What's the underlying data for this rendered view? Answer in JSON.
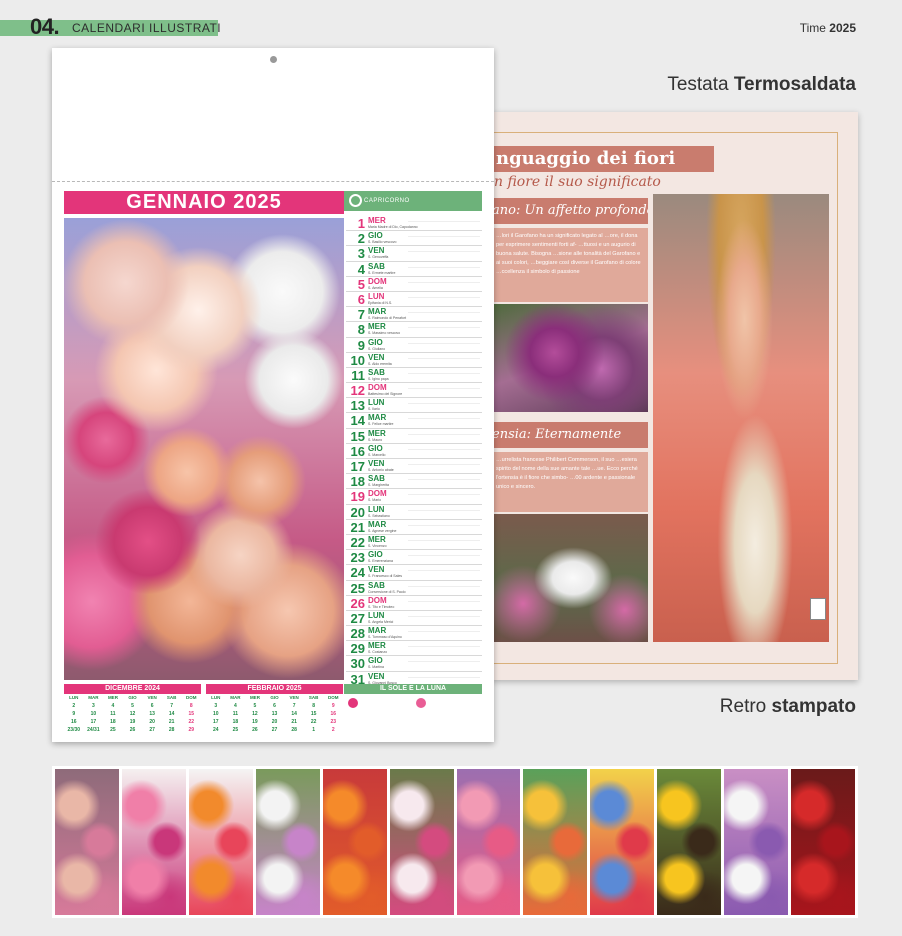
{
  "header": {
    "section_number": "04.",
    "section_title": "CALENDARI ILLUSTRATI",
    "brand": "Time",
    "year": "2025"
  },
  "captions": {
    "top_prefix": "Testata",
    "top_strong": "Termosaldata",
    "bottom_prefix": "Retro",
    "bottom_strong": "stampato"
  },
  "back": {
    "title": "nguaggio dei fiori",
    "subtitle": "n fiore il suo significato",
    "band1": "ano: Un affetto profondo",
    "text1": "…lori il Garofano ha un significato legato al …ore, il dona per esprimere sentimenti forti af- …ttuosi e un augurio di buona salute. Bisogna …sione alle tonalità del Garofano e ai suoi colori, …beggiare così diverse il Garofano di colore …ccellenza il simbolo di passione",
    "band2": "ensia: Eternamente",
    "text2": "…urrelista francese Philibert Commerson, il suo …esiera spirito del nome della sue amante tale …ue. Ecco perché l'ortensia è il fiore che simbo- …00 ardente e passionale unico e sincero."
  },
  "front": {
    "month_title": "GENNAIO 2025",
    "side_header": "CAPRICORNO",
    "days": [
      {
        "n": "1",
        "w": "MER",
        "s": "Maria Madre di Dio, Capodanno",
        "red": true
      },
      {
        "n": "2",
        "w": "GIO",
        "s": "S. Basilio vescovo",
        "red": false
      },
      {
        "n": "3",
        "w": "VEN",
        "s": "S. Genoveffa",
        "red": false
      },
      {
        "n": "4",
        "w": "SAB",
        "s": "S. Ermete martire",
        "red": false
      },
      {
        "n": "5",
        "w": "DOM",
        "s": "S. Amelia",
        "red": true
      },
      {
        "n": "6",
        "w": "LUN",
        "s": "Epifania di N.S.",
        "red": true
      },
      {
        "n": "7",
        "w": "MAR",
        "s": "S. Raimondo di Penafort",
        "red": false
      },
      {
        "n": "8",
        "w": "MER",
        "s": "S. Massimo vescovo",
        "red": false
      },
      {
        "n": "9",
        "w": "GIO",
        "s": "S. Giuliano",
        "red": false
      },
      {
        "n": "10",
        "w": "VEN",
        "s": "S. Aldo eremita",
        "red": false
      },
      {
        "n": "11",
        "w": "SAB",
        "s": "S. Igino papa",
        "red": false
      },
      {
        "n": "12",
        "w": "DOM",
        "s": "Battesimo del Signore",
        "red": true
      },
      {
        "n": "13",
        "w": "LUN",
        "s": "S. Ilario",
        "red": false
      },
      {
        "n": "14",
        "w": "MAR",
        "s": "S. Felice martire",
        "red": false
      },
      {
        "n": "15",
        "w": "MER",
        "s": "S. Mauro",
        "red": false
      },
      {
        "n": "16",
        "w": "GIO",
        "s": "S. Marcello",
        "red": false
      },
      {
        "n": "17",
        "w": "VEN",
        "s": "S. Antonio abate",
        "red": false
      },
      {
        "n": "18",
        "w": "SAB",
        "s": "S. Margherita",
        "red": false
      },
      {
        "n": "19",
        "w": "DOM",
        "s": "S. Mario",
        "red": true
      },
      {
        "n": "20",
        "w": "LUN",
        "s": "S. Sebastiano",
        "red": false
      },
      {
        "n": "21",
        "w": "MAR",
        "s": "S. Agnese vergine",
        "red": false
      },
      {
        "n": "22",
        "w": "MER",
        "s": "S. Vincenzo",
        "red": false
      },
      {
        "n": "23",
        "w": "GIO",
        "s": "S. Emerenziana",
        "red": false
      },
      {
        "n": "24",
        "w": "VEN",
        "s": "S. Francesco di Sales",
        "red": false
      },
      {
        "n": "25",
        "w": "SAB",
        "s": "Conversione di S. Paolo",
        "red": false
      },
      {
        "n": "26",
        "w": "DOM",
        "s": "S. Tito e Timoteo",
        "red": true
      },
      {
        "n": "27",
        "w": "LUN",
        "s": "S. Angela Merici",
        "red": false
      },
      {
        "n": "28",
        "w": "MAR",
        "s": "S. Tommaso d'Aquino",
        "red": false
      },
      {
        "n": "29",
        "w": "MER",
        "s": "S. Costanzo",
        "red": false
      },
      {
        "n": "30",
        "w": "GIO",
        "s": "S. Martina",
        "red": false
      },
      {
        "n": "31",
        "w": "VEN",
        "s": "S. Giovanni Bosco",
        "red": false
      }
    ],
    "mini_dec": {
      "title": "DICEMBRE 2024",
      "headers": [
        "LUN",
        "MAR",
        "MER",
        "GIO",
        "VEN",
        "SAB",
        "DOM"
      ],
      "rows": [
        [
          "2",
          "3",
          "4",
          "5",
          "6",
          "7",
          "8"
        ],
        [
          "9",
          "10",
          "11",
          "12",
          "13",
          "14",
          "15"
        ],
        [
          "16",
          "17",
          "18",
          "19",
          "20",
          "21",
          "22"
        ],
        [
          "23/30",
          "24/31",
          "25",
          "26",
          "27",
          "28",
          "29"
        ]
      ]
    },
    "mini_feb": {
      "title": "FEBBRAIO 2025",
      "headers": [
        "LUN",
        "MAR",
        "MER",
        "GIO",
        "VEN",
        "SAB",
        "DOM"
      ],
      "rows": [
        [
          "3",
          "4",
          "5",
          "6",
          "7",
          "8",
          "9"
        ],
        [
          "10",
          "11",
          "12",
          "13",
          "14",
          "15",
          "16"
        ],
        [
          "17",
          "18",
          "19",
          "20",
          "21",
          "22",
          "23"
        ],
        [
          "24",
          "25",
          "26",
          "27",
          "28",
          "1",
          "2"
        ]
      ]
    },
    "sun_moon_title": "IL SOLE E LA LUNA"
  },
  "thumbnails": [
    {
      "name": "thumb-roses-pastel",
      "c1": "#e9b7a7",
      "c2": "#d77a9a",
      "c3": "#8e6b7a"
    },
    {
      "name": "thumb-orchids-pink",
      "c1": "#f07fa8",
      "c2": "#c9377a",
      "c3": "#f5f0f0"
    },
    {
      "name": "thumb-mixed-orange",
      "c1": "#f28a2c",
      "c2": "#e8455a",
      "c3": "#f4f4f4"
    },
    {
      "name": "thumb-white-lilac",
      "c1": "#f3f3f3",
      "c2": "#c784c9",
      "c3": "#7a9a5c"
    },
    {
      "name": "thumb-tulips",
      "c1": "#f58a2a",
      "c2": "#e25c2a",
      "c3": "#c83a3a"
    },
    {
      "name": "thumb-orchids-white",
      "c1": "#f7e9ee",
      "c2": "#d44b7f",
      "c3": "#6a7a4a"
    },
    {
      "name": "thumb-gerbera-pink",
      "c1": "#f29ab4",
      "c2": "#e75b86",
      "c3": "#9c6fb0"
    },
    {
      "name": "thumb-gerbera-yellow",
      "c1": "#f6c13a",
      "c2": "#e86a3a",
      "c3": "#5aa15a"
    },
    {
      "name": "thumb-hydrangea-mix",
      "c1": "#5b8ad6",
      "c2": "#e03a4a",
      "c3": "#f2d24a"
    },
    {
      "name": "thumb-sunflowers",
      "c1": "#f7c51f",
      "c2": "#3a2a1a",
      "c3": "#6a8a3a"
    },
    {
      "name": "thumb-white-purple",
      "c1": "#f5f5f5",
      "c2": "#8a5ab0",
      "c3": "#c98fc4"
    },
    {
      "name": "thumb-red-roses",
      "c1": "#d62a2a",
      "c2": "#a8151c",
      "c3": "#6a1a1a"
    }
  ]
}
